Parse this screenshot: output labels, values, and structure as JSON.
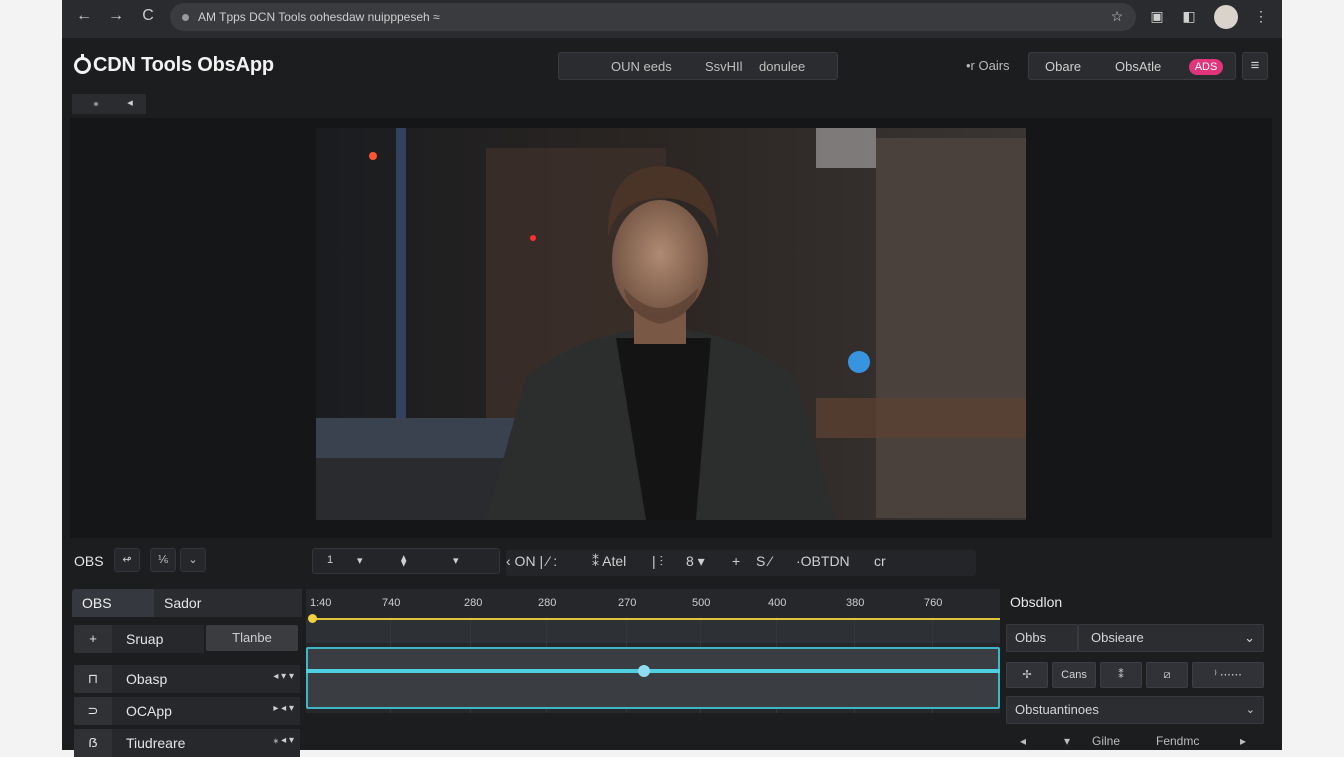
{
  "browser": {
    "url": "AM Tpps DCN Tools oohesdaw   nuipppeseh   ≈",
    "nav": {
      "back": "←",
      "forward": "→",
      "reload": "C"
    },
    "icons": {
      "bookmark": "☆",
      "ext1": "▣",
      "ext2": "◧",
      "menu": "⋮"
    }
  },
  "header": {
    "logo": "CDN Tools ObsApp",
    "center_seg": [
      "OUN eeds",
      "SsvHIl",
      "donulee"
    ],
    "left_text": "•r Oairs",
    "right_seg": [
      "Obare",
      "ObsAtle"
    ],
    "live_badge": "ADS",
    "menu": "≡"
  },
  "mini_toolbar": [
    "⁎",
    "◂"
  ],
  "controls": {
    "obs_label": "OBS",
    "small_btns": [
      "↫",
      "⅙",
      "⌄"
    ],
    "transport": [
      "1",
      "▾",
      "⧫",
      "▾"
    ],
    "text_items": [
      "‹ ON | ⁄ :",
      "⁑ Atel",
      "| ⫶",
      "8 ▾",
      "+",
      "S ⁄",
      "·OBTDN",
      "cr"
    ]
  },
  "left_panel": {
    "tabs": [
      "OBS",
      "Sador"
    ],
    "add_row": {
      "icon": "+",
      "label": "Sruap",
      "button": "Tlanbe"
    },
    "sources": [
      {
        "icon": "⊓",
        "label": "Obasp",
        "ctl": "◂   ▾  ▾"
      },
      {
        "icon": "⊃",
        "label": "OCApp",
        "ctl": "▸ ◂  ▾"
      },
      {
        "icon": "ẞ",
        "label": "Tiudreare",
        "ctl": "⁎ ◂  ▾"
      }
    ]
  },
  "timeline": {
    "ticks": [
      "1:40",
      "740",
      "280",
      "280",
      "270",
      "500",
      "400",
      "380",
      "760"
    ]
  },
  "right_panel": {
    "title": "Obsdlon",
    "select_left": "Obbs",
    "select_right": "Obsieare",
    "select_chevron": "⌄",
    "buttons": [
      "✢",
      "Cans",
      "⁑",
      "⧄",
      "⁾ ⋯⋯"
    ],
    "section": "Obstuantinoes",
    "section_chevron": "⌄",
    "footer": [
      "◂",
      "▾",
      "Gilne",
      "Fendmc",
      "▸"
    ]
  },
  "colors": {
    "accent_live": "#e0357a",
    "timeline_yellow": "#e0c43c",
    "timeline_cyan": "#4fd0e0"
  }
}
